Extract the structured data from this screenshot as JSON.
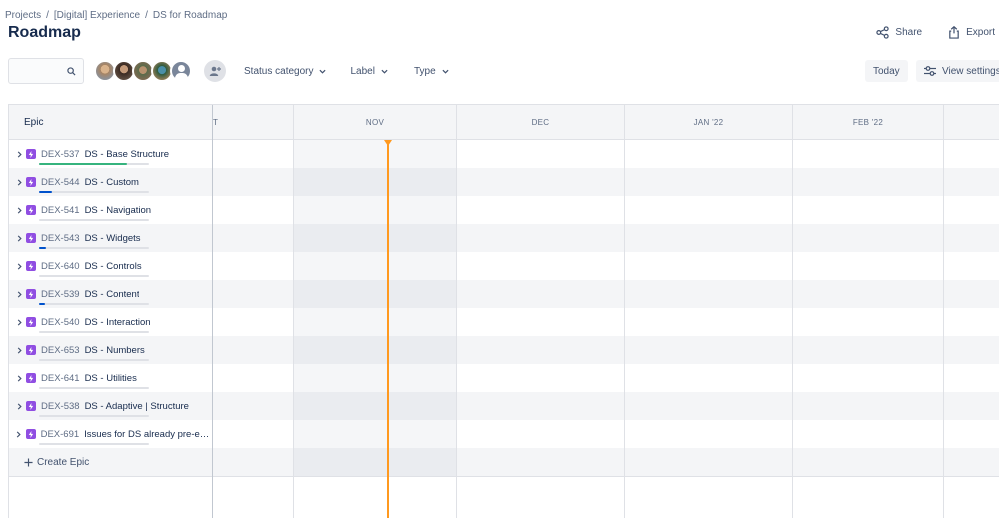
{
  "breadcrumb": [
    "Projects",
    "[Digital] Experience",
    "DS for Roadmap"
  ],
  "page_title": "Roadmap",
  "actions": {
    "share": "Share",
    "export": "Export"
  },
  "toolbar": {
    "search_placeholder": "",
    "filters": [
      "Status category",
      "Label",
      "Type"
    ],
    "today": "Today",
    "view_settings": "View settings"
  },
  "epic_header": "Epic",
  "months": [
    "T",
    "NOV",
    "DEC",
    "JAN '22",
    "FEB '22"
  ],
  "epics": [
    {
      "key": "DEX-537",
      "summary": "DS - Base Structure",
      "progress_done": 0.8,
      "progress_in": 0.0
    },
    {
      "key": "DEX-544",
      "summary": "DS - Custom",
      "progress_done": 0.0,
      "progress_in": 0.12
    },
    {
      "key": "DEX-541",
      "summary": "DS - Navigation",
      "progress_done": 0.0,
      "progress_in": 0.0
    },
    {
      "key": "DEX-543",
      "summary": "DS - Widgets",
      "progress_done": 0.0,
      "progress_in": 0.06
    },
    {
      "key": "DEX-640",
      "summary": "DS - Controls",
      "progress_done": 0.0,
      "progress_in": 0.0
    },
    {
      "key": "DEX-539",
      "summary": "DS - Content",
      "progress_done": 0.0,
      "progress_in": 0.05
    },
    {
      "key": "DEX-540",
      "summary": "DS - Interaction",
      "progress_done": 0.0,
      "progress_in": 0.0
    },
    {
      "key": "DEX-653",
      "summary": "DS - Numbers",
      "progress_done": 0.0,
      "progress_in": 0.0
    },
    {
      "key": "DEX-641",
      "summary": "DS - Utilities",
      "progress_done": 0.0,
      "progress_in": 0.0
    },
    {
      "key": "DEX-538",
      "summary": "DS - Adaptive | Structure",
      "progress_done": 0.0,
      "progress_in": 0.0
    },
    {
      "key": "DEX-691",
      "summary": "Issues for DS already pre-exi...",
      "progress_done": 0.0,
      "progress_in": 0.0
    }
  ],
  "create_epic": "Create Epic",
  "colors": {
    "done": "#36b37e",
    "in_progress": "#0052cc",
    "today": "#ff991f",
    "epic": "#904ee2"
  }
}
